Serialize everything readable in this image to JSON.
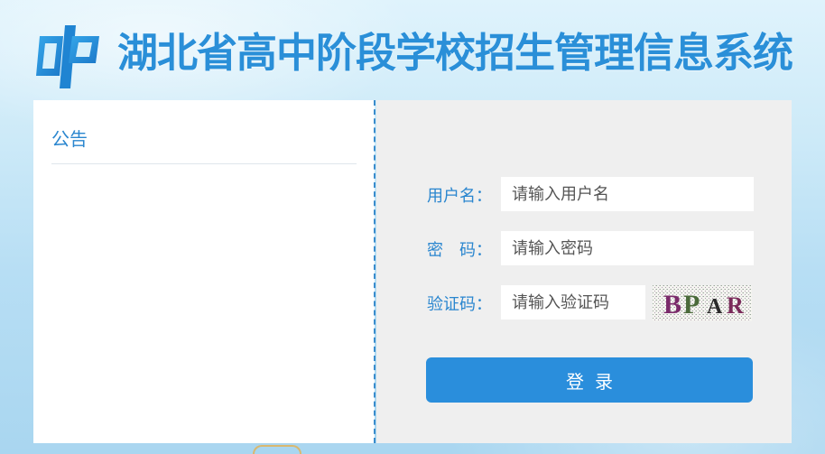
{
  "header": {
    "title": "湖北省高中阶段学校招生管理信息系统",
    "logo_icon": "hp-logo-icon"
  },
  "notice": {
    "title": "公告"
  },
  "login": {
    "username_label": "用户名：",
    "username_placeholder": "请输入用户名",
    "password_label": "密　码：",
    "password_placeholder": "请输入密码",
    "captcha_label": "验证码：",
    "captcha_placeholder": "请输入验证码",
    "captcha_text": "BPAR",
    "captcha_colors": [
      "#7a2a6a",
      "#4a6a3a",
      "#2a2a2a",
      "#7a2a5a"
    ],
    "submit_label": "登录"
  },
  "colors": {
    "accent": "#2a8edc",
    "title": "#2a8fd8",
    "label": "#2a86cf",
    "panel_bg": "#efefef"
  }
}
